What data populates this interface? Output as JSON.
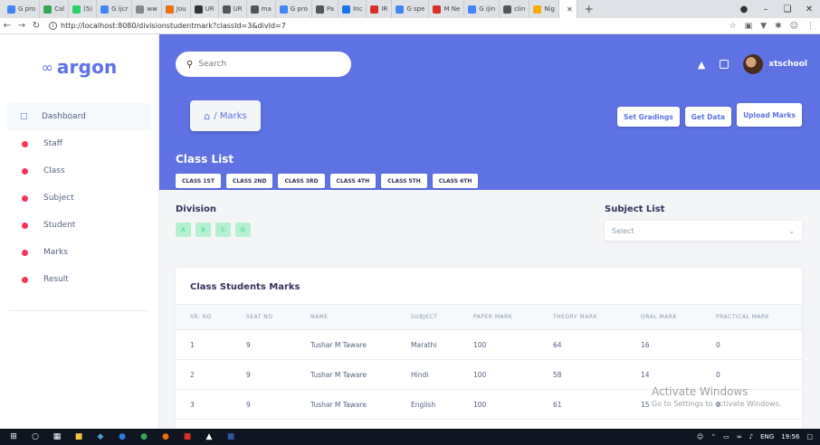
{
  "browser": {
    "tabs": [
      {
        "label": "G pro",
        "color": "#4285f4"
      },
      {
        "label": "Cal",
        "color": "#34a853"
      },
      {
        "label": "(5)",
        "color": "#25d366"
      },
      {
        "label": "G ijcr",
        "color": "#4285f4"
      },
      {
        "label": "ww",
        "color": "#888888"
      },
      {
        "label": "Jou",
        "color": "#e8710a"
      },
      {
        "label": "UR",
        "color": "#333333"
      },
      {
        "label": "UR",
        "color": "#555555"
      },
      {
        "label": "ma",
        "color": "#555555"
      },
      {
        "label": "G pro",
        "color": "#4285f4"
      },
      {
        "label": "Pa",
        "color": "#555555"
      },
      {
        "label": "Inc",
        "color": "#1a73e8"
      },
      {
        "label": "IR",
        "color": "#d93025"
      },
      {
        "label": "G spe",
        "color": "#4285f4"
      },
      {
        "label": "M Ne",
        "color": "#d93025"
      },
      {
        "label": "G ijin",
        "color": "#4285f4"
      },
      {
        "label": "clin",
        "color": "#555555"
      },
      {
        "label": "Nig",
        "color": "#f9ab00"
      }
    ],
    "active_tab_glyph": "✕",
    "new_tab": "+",
    "url": "http://localhost:8080/divisionstudentmark?classId=3&divId=7"
  },
  "sidebar": {
    "logo": "argon",
    "items": [
      {
        "label": "Dashboard"
      },
      {
        "label": "Staff"
      },
      {
        "label": "Class"
      },
      {
        "label": "Subject"
      },
      {
        "label": "Student"
      },
      {
        "label": "Marks"
      },
      {
        "label": "Result"
      }
    ]
  },
  "header": {
    "search_placeholder": "Search",
    "username": "xtschool",
    "breadcrumb": "/ Marks",
    "buttons": {
      "set_gradings": "Set Gradings",
      "get_data": "Get Data",
      "upload_marks": "Upload Marks"
    }
  },
  "class_list": {
    "title": "Class List",
    "classes": [
      "CLASS 1ST",
      "CLASS 2ND",
      "CLASS 3RD",
      "CLASS 4TH",
      "CLASS 5TH",
      "CLASS 6TH"
    ]
  },
  "division": {
    "title": "Division",
    "items": [
      "A",
      "B",
      "C",
      "D"
    ]
  },
  "subject_list": {
    "title": "Subject List",
    "selected": "Select"
  },
  "marks_table": {
    "title": "Class Students Marks",
    "columns": [
      "SR. NO",
      "SEAT NO",
      "NAME",
      "SUBJECT",
      "PAPER MARK",
      "THEORY MARK",
      "ORAL MARK",
      "PRACTICAL MARK"
    ],
    "rows": [
      [
        "1",
        "9",
        "Tushar M Taware",
        "Marathi",
        "100",
        "64",
        "16",
        "0"
      ],
      [
        "2",
        "9",
        "Tushar M Taware",
        "Hindi",
        "100",
        "58",
        "14",
        "0"
      ],
      [
        "3",
        "9",
        "Tushar M Taware",
        "English",
        "100",
        "61",
        "15",
        "0"
      ]
    ]
  },
  "watermark": {
    "line1": "Activate Windows",
    "line2": "Go to Settings to activate Windows."
  },
  "taskbar": {
    "lang": "ENG",
    "time": "19:56"
  },
  "colors": {
    "primary": "#5e72e4",
    "success_light": "#b5f1d0",
    "danger": "#f5365c"
  }
}
